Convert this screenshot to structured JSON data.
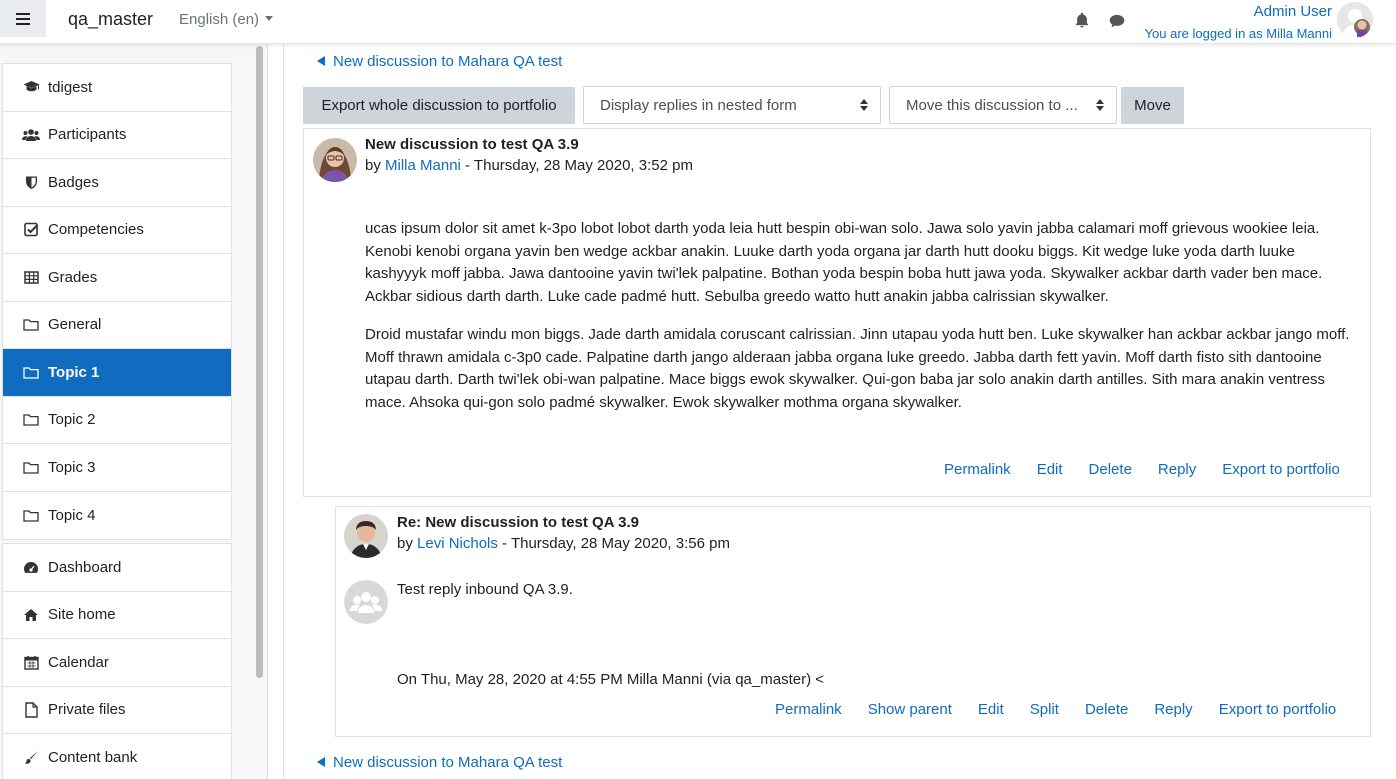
{
  "navbar": {
    "site_name": "qa_master",
    "language": "English (en)",
    "user_name": "Admin User",
    "logged_in_as": "You are logged in as Milla Manni"
  },
  "drawer": {
    "course_items": [
      {
        "label": "tdigest",
        "icon": "graduation-cap-icon"
      },
      {
        "label": "Participants",
        "icon": "users-icon"
      },
      {
        "label": "Badges",
        "icon": "shield-icon"
      },
      {
        "label": "Competencies",
        "icon": "check-square-icon"
      },
      {
        "label": "Grades",
        "icon": "table-icon"
      },
      {
        "label": "General",
        "icon": "folder-icon"
      },
      {
        "label": "Topic 1",
        "icon": "folder-icon",
        "active": true
      },
      {
        "label": "Topic 2",
        "icon": "folder-icon"
      },
      {
        "label": "Topic 3",
        "icon": "folder-icon"
      },
      {
        "label": "Topic 4",
        "icon": "folder-icon"
      }
    ],
    "site_items": [
      {
        "label": "Dashboard",
        "icon": "dashboard-icon"
      },
      {
        "label": "Site home",
        "icon": "home-icon"
      },
      {
        "label": "Calendar",
        "icon": "calendar-icon"
      },
      {
        "label": "Private files",
        "icon": "file-icon"
      },
      {
        "label": "Content bank",
        "icon": "paintbrush-icon"
      }
    ]
  },
  "toolbar": {
    "back_link_top": "New discussion to Mahara QA test",
    "back_link_bottom": "New discussion to Mahara QA test",
    "export_button": "Export whole discussion to portfolio",
    "display_select": "Display replies in nested form",
    "move_select": "Move this discussion to ...",
    "move_button": "Move"
  },
  "post1": {
    "subject": "New discussion to test QA 3.9",
    "by": "by",
    "author": "Milla Manni",
    "date": " - Thursday, 28 May 2020, 3:52 pm",
    "paragraphs": [
      "ucas ipsum dolor sit amet k-3po lobot lobot darth yoda leia hutt bespin obi-wan solo. Jawa solo yavin jabba calamari moff grievous wookiee leia. Kenobi kenobi organa yavin ben wedge ackbar anakin. Luuke darth yoda organa jar darth hutt dooku biggs. Kit wedge luke yoda darth luuke kashyyyk moff jabba. Jawa dantooine yavin twi'lek palpatine. Bothan yoda bespin boba hutt jawa yoda. Skywalker ackbar darth vader ben mace. Ackbar sidious darth darth. Luke cade padmé hutt. Sebulba greedo watto hutt anakin jabba calrissian skywalker.",
      "Droid mustafar windu mon biggs. Jade darth amidala coruscant calrissian. Jinn utapau yoda hutt ben. Luke skywalker han ackbar ackbar jango moff. Moff thrawn amidala c-3p0 cade. Palpatine darth jango alderaan jabba organa luke greedo. Jabba darth fett yavin. Moff darth fisto sith dantooine utapau darth. Darth twi'lek obi-wan palpatine. Mace biggs ewok skywalker. Qui-gon baba jar solo anakin darth antilles. Sith mara anakin ventress mace. Ahsoka qui-gon solo padmé skywalker. Ewok skywalker mothma organa skywalker."
    ],
    "actions": [
      "Permalink",
      "Edit",
      "Delete",
      "Reply",
      "Export to portfolio"
    ]
  },
  "post2": {
    "subject": "Re: New discussion to test QA 3.9",
    "by": "by",
    "author": "Levi Nichols",
    "date": " - Thursday, 28 May 2020, 3:56 pm",
    "body": "Test reply inbound QA 3.9.",
    "quote": "On Thu, May 28, 2020 at 4:55 PM Milla Manni (via qa_master) <",
    "actions": [
      "Permalink",
      "Show parent",
      "Edit",
      "Split",
      "Delete",
      "Reply",
      "Export to portfolio"
    ]
  }
}
